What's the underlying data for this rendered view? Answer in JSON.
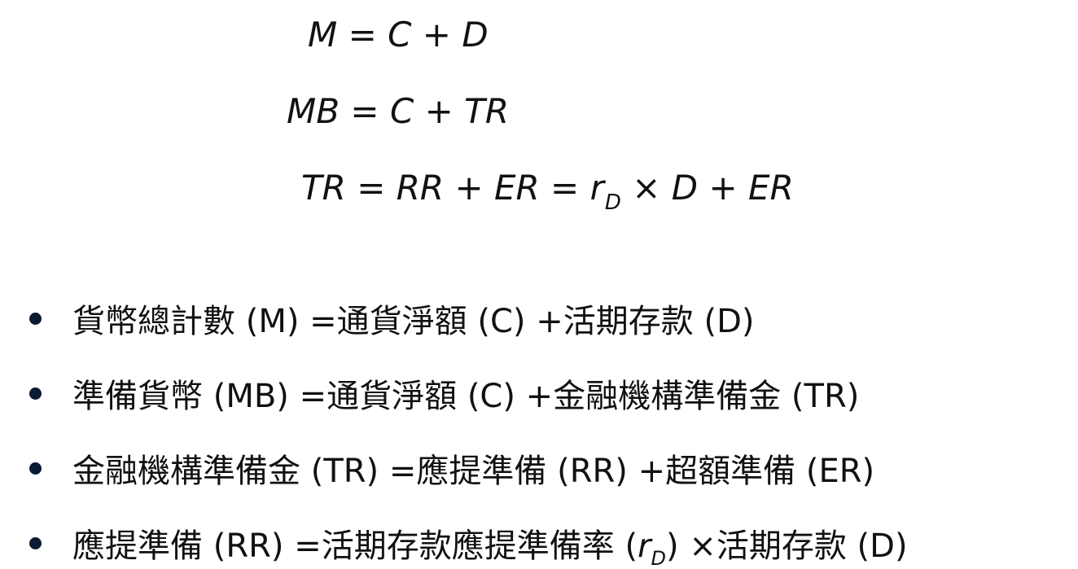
{
  "equations": [
    {
      "text": "M = C + D"
    },
    {
      "text": "MB = C + TR"
    },
    {
      "main": "TR = RR + ER = r",
      "subscript": "D",
      "tail": " × D + ER"
    }
  ],
  "bullets": [
    {
      "text": "貨幣總計數 (M) =通貨淨額 (C) +活期存款 (D)"
    },
    {
      "text": "準備貨幣 (MB) =通貨淨額 (C) +金融機構準備金 (TR)"
    },
    {
      "text": "金融機構準備金 (TR) =應提準備 (RR) +超額準備 (ER)"
    },
    {
      "before": "應提準備 (RR) =活期存款應提準備率 (",
      "italic": "r",
      "subscript": "D",
      "after": ") ×活期存款 (D)"
    }
  ],
  "colors": {
    "text": "#111111",
    "bullet": "#0b1a33",
    "background": "#ffffff"
  }
}
